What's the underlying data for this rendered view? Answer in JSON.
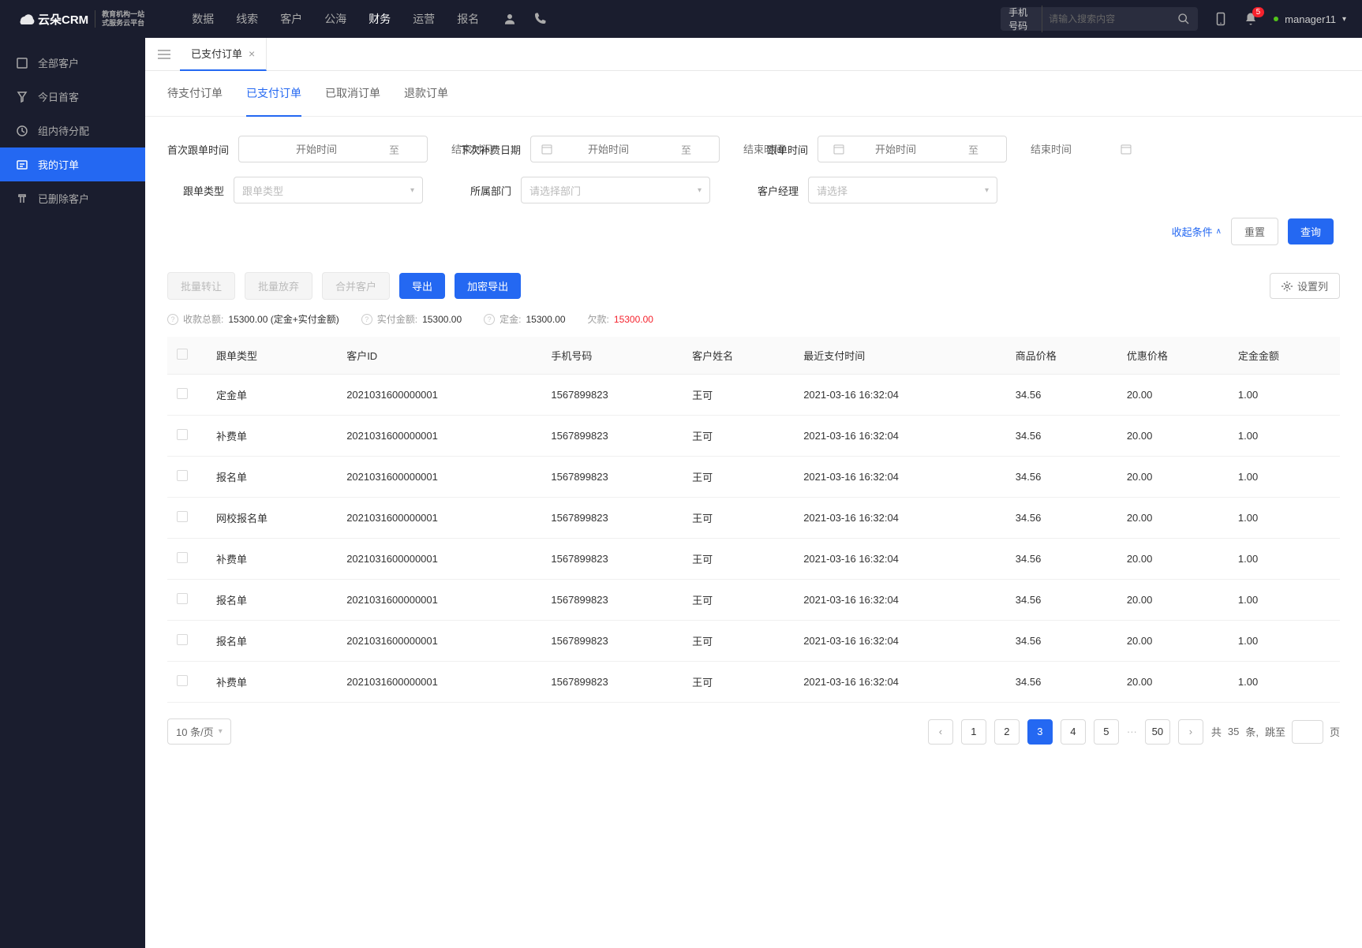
{
  "header": {
    "logo_text": "云朵CRM",
    "logo_sub1": "教育机构一站",
    "logo_sub2": "式服务云平台",
    "nav": [
      "数据",
      "线索",
      "客户",
      "公海",
      "财务",
      "运营",
      "报名"
    ],
    "nav_active_index": 4,
    "search_type": "手机号码",
    "search_placeholder": "请输入搜索内容",
    "notification_count": "5",
    "user_name": "manager11"
  },
  "sidebar": {
    "items": [
      {
        "label": "全部客户"
      },
      {
        "label": "今日首客"
      },
      {
        "label": "组内待分配"
      },
      {
        "label": "我的订单"
      },
      {
        "label": "已删除客户"
      }
    ],
    "active_index": 3
  },
  "tab_bar": {
    "tab_label": "已支付订单"
  },
  "sub_tabs": {
    "items": [
      "待支付订单",
      "已支付订单",
      "已取消订单",
      "退款订单"
    ],
    "active_index": 1
  },
  "filters": {
    "first_follow_label": "首次跟单时间",
    "start_placeholder": "开始时间",
    "to_label": "至",
    "end_placeholder": "结束时间",
    "next_fee_label": "下次补费日期",
    "follow_time_label": "跟单时间",
    "follow_type_label": "跟单类型",
    "follow_type_placeholder": "跟单类型",
    "dept_label": "所属部门",
    "dept_placeholder": "请选择部门",
    "manager_label": "客户经理",
    "manager_placeholder": "请选择",
    "collapse_label": "收起条件",
    "reset_label": "重置",
    "query_label": "查询"
  },
  "toolbar": {
    "batch_transfer": "批量转让",
    "batch_abandon": "批量放弃",
    "merge_customer": "合并客户",
    "export": "导出",
    "encrypt_export": "加密导出",
    "settings_col": "设置列"
  },
  "summary": {
    "total_label": "收款总额:",
    "total_value": "15300.00 (定金+实付金额)",
    "paid_label": "实付金额:",
    "paid_value": "15300.00",
    "deposit_label": "定金:",
    "deposit_value": "15300.00",
    "debt_label": "欠款:",
    "debt_value": "15300.00"
  },
  "table": {
    "headers": [
      "跟单类型",
      "客户ID",
      "手机号码",
      "客户姓名",
      "最近支付时间",
      "商品价格",
      "优惠价格",
      "定金金额"
    ],
    "rows": [
      {
        "type": "定金单",
        "id": "2021031600000001",
        "phone": "1567899823",
        "name": "王可",
        "time": "2021-03-16 16:32:04",
        "price": "34.56",
        "discount": "20.00",
        "deposit": "1.00"
      },
      {
        "type": "补费单",
        "id": "2021031600000001",
        "phone": "1567899823",
        "name": "王可",
        "time": "2021-03-16 16:32:04",
        "price": "34.56",
        "discount": "20.00",
        "deposit": "1.00"
      },
      {
        "type": "报名单",
        "id": "2021031600000001",
        "phone": "1567899823",
        "name": "王可",
        "time": "2021-03-16 16:32:04",
        "price": "34.56",
        "discount": "20.00",
        "deposit": "1.00"
      },
      {
        "type": "网校报名单",
        "id": "2021031600000001",
        "phone": "1567899823",
        "name": "王可",
        "time": "2021-03-16 16:32:04",
        "price": "34.56",
        "discount": "20.00",
        "deposit": "1.00"
      },
      {
        "type": "补费单",
        "id": "2021031600000001",
        "phone": "1567899823",
        "name": "王可",
        "time": "2021-03-16 16:32:04",
        "price": "34.56",
        "discount": "20.00",
        "deposit": "1.00"
      },
      {
        "type": "报名单",
        "id": "2021031600000001",
        "phone": "1567899823",
        "name": "王可",
        "time": "2021-03-16 16:32:04",
        "price": "34.56",
        "discount": "20.00",
        "deposit": "1.00"
      },
      {
        "type": "报名单",
        "id": "2021031600000001",
        "phone": "1567899823",
        "name": "王可",
        "time": "2021-03-16 16:32:04",
        "price": "34.56",
        "discount": "20.00",
        "deposit": "1.00"
      },
      {
        "type": "补费单",
        "id": "2021031600000001",
        "phone": "1567899823",
        "name": "王可",
        "time": "2021-03-16 16:32:04",
        "price": "34.56",
        "discount": "20.00",
        "deposit": "1.00"
      }
    ]
  },
  "pagination": {
    "page_size_label": "10 条/页",
    "pages": [
      "1",
      "2",
      "3",
      "4",
      "5"
    ],
    "last_page": "50",
    "active_page": "3",
    "total_prefix": "共",
    "total_count": "35",
    "total_suffix": "条,",
    "jump_label": "跳至",
    "page_unit": "页"
  }
}
